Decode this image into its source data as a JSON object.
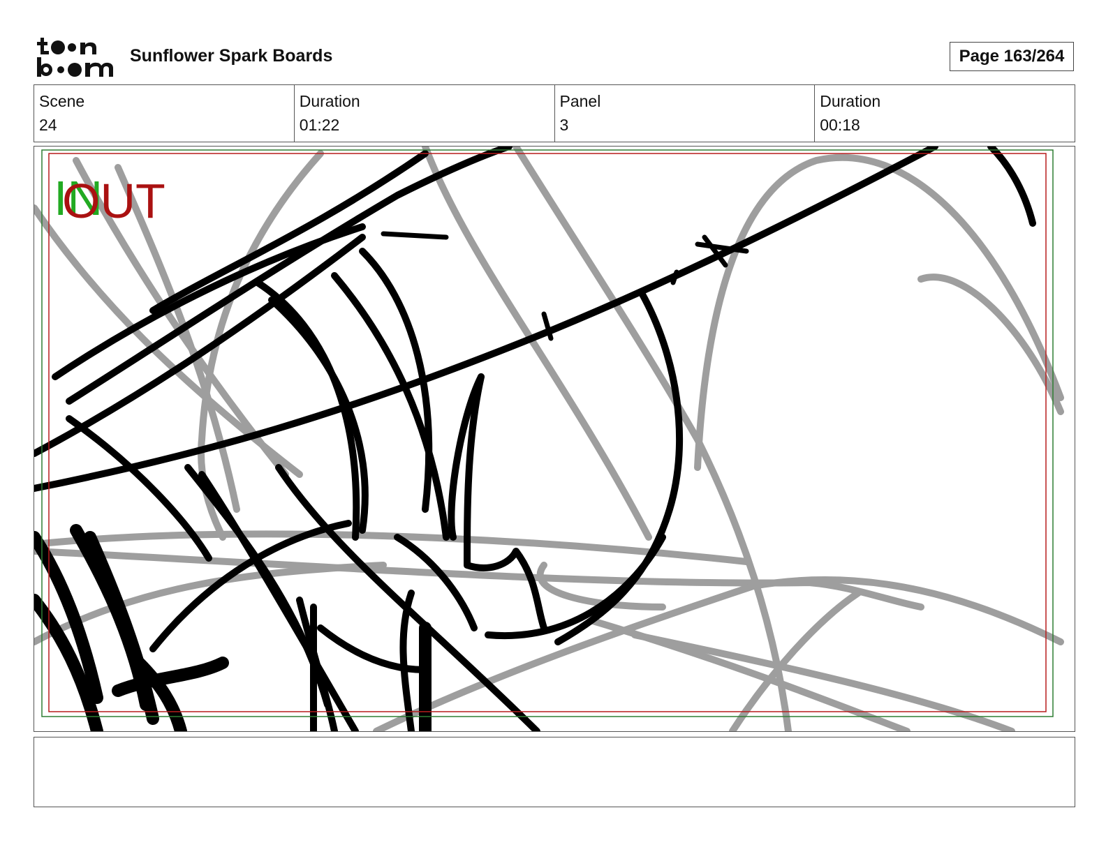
{
  "header": {
    "logo_text_top": "toon",
    "logo_text_bottom": "boom",
    "project_title": "Sunflower Spark Boards",
    "page_label": "Page 163/264"
  },
  "info": {
    "scene_label": "Scene",
    "scene_value": "24",
    "scene_duration_label": "Duration",
    "scene_duration_value": "01:22",
    "panel_label": "Panel",
    "panel_value": "3",
    "panel_duration_label": "Duration",
    "panel_duration_value": "00:18"
  },
  "panel": {
    "in_marker": "IN",
    "out_marker": "OUT",
    "in_color": "#22aa22",
    "out_color": "#aa1111",
    "safe_frame_color": "#2e7d32",
    "action_frame_color": "#b71c1c",
    "sketch_dark_color": "#000000",
    "sketch_light_color": "#9e9e9e"
  },
  "notes": {
    "text": ""
  }
}
